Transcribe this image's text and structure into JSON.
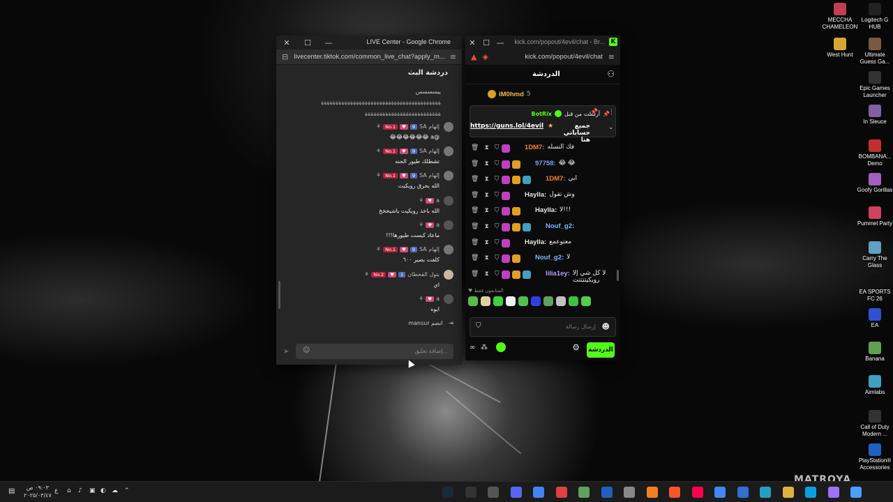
{
  "desktop_icons": [
    {
      "label": "MECCHA CHAMELEON",
      "icon": "meccha-chameleon-icon",
      "color": "#c04050"
    },
    {
      "label": "Logitech G HUB",
      "icon": "logitech-g-icon",
      "color": "#222222"
    },
    {
      "label": "West Hunt",
      "icon": "west-hunt-icon",
      "color": "#d8a530"
    },
    {
      "label": "Ultimate Guess Ga...",
      "icon": "guess-game-icon",
      "color": "#7a5a40"
    },
    {
      "label": "Epic Games Launcher",
      "icon": "epic-games-icon",
      "color": "#333333"
    },
    {
      "label": "In Sleuce",
      "icon": "in-sleuce-icon",
      "color": "#8060a0"
    },
    {
      "label": "BOMBANA... Demo",
      "icon": "bombana-icon",
      "color": "#c03030"
    },
    {
      "label": "Goofy Gorillas",
      "icon": "goofy-gorillas-icon",
      "color": "#a060c0"
    },
    {
      "label": "Pummel Party",
      "icon": "pummel-party-icon",
      "color": "#d04060"
    },
    {
      "label": "Carry The Glass",
      "icon": "carry-glass-icon",
      "color": "#60a0c0"
    },
    {
      "label": "EA SPORTS FC 26",
      "icon": "ea-fc-icon",
      "color": "#111111"
    },
    {
      "label": "EA",
      "icon": "ea-icon",
      "color": "#3050d0"
    },
    {
      "label": "Banana",
      "icon": "banana-icon",
      "color": "#60a050"
    },
    {
      "label": "Aimlabs",
      "icon": "aimlabs-icon",
      "color": "#40a0c0"
    },
    {
      "label": "Call of Duty Modern ...",
      "icon": "call-of-duty-icon",
      "color": "#333333"
    },
    {
      "label": "PlayStation® Accessories",
      "icon": "playstation-icon",
      "color": "#2060c0"
    }
  ],
  "tiktok_window": {
    "title": "LIVE Center - Google Chrome",
    "url": "livecenter.tiktok.com/common_live_chat?apply_m...",
    "chat_title": "دردشة البث",
    "top_lines": [
      "ييسسسس",
      "ةةةةةةةةةةةةةةةةةةةةةةةةةةةةةةةةةةةةةةةةة",
      "ةةةةةةةةةةةةةةةةةةةةةةةةةة"
    ],
    "messages": [
      {
        "user": "إلهام SA",
        "level": "9",
        "rank": "No.1",
        "text": "@a 😂😂😂😂😂😂",
        "avatar_color": "#777777"
      },
      {
        "user": "إلهام SA",
        "level": "9",
        "rank": "No.1",
        "text": "تشطلك طيور الجنه",
        "avatar_color": "#777777"
      },
      {
        "user": "إلهام SA",
        "level": "9",
        "rank": "No.1",
        "text": "الله يحرق رويكيت",
        "avatar_color": "#777777"
      },
      {
        "user": "a",
        "level": "",
        "rank": "",
        "text": "الله ياخذ رويكيت ياشيخخخ",
        "avatar_color": "#555555"
      },
      {
        "user": "a",
        "level": "",
        "rank": "",
        "text": "ماعاد كبست طيورها!!!",
        "avatar_color": "#555555"
      },
      {
        "user": "إلهام SA",
        "level": "9",
        "rank": "No.1",
        "text": "كلفت بصير ٦٠٠",
        "avatar_color": "#777777"
      },
      {
        "user": "بتول القحطان",
        "level": "1",
        "rank": "No.2",
        "text": "اي",
        "avatar_color": "#c8b8a0"
      },
      {
        "user": "a",
        "level": "",
        "rank": "",
        "text": "ايوه",
        "avatar_color": "#555555"
      }
    ],
    "join_text": "mansur انضم",
    "input_placeholder": "إضافة تعليق..."
  },
  "kick_window": {
    "title": "kick.com/popout/4evil/chat - Br...",
    "url": "kick.com/popout/4evil/chat",
    "chat_title": "الدردشة",
    "top_user": "iM0hmd",
    "top_count": "5",
    "pinned": {
      "sent_by": "أرسلت من قبل",
      "user": "BotRix",
      "text": "جميع حساباتي هنا",
      "link": "https://guns.lol/4evil"
    },
    "messages": [
      {
        "user": "1DM7:",
        "color": "#f08030",
        "text": "فك النسله"
      },
      {
        "user": "97758:",
        "color": "#7aa0ff",
        "text": "😂 😂"
      },
      {
        "user": "1DM7:",
        "color": "#f08030",
        "text": "ابي"
      },
      {
        "user": "Haylla:",
        "color": "#e8e8e8",
        "text": "وش تقول"
      },
      {
        "user": "Haylla:",
        "color": "#e8e8e8",
        "text": "لا!!!"
      },
      {
        "user": "Nouf_g2:",
        "color": "#7ab8ff",
        "text": ""
      },
      {
        "user": "Haylla:",
        "color": "#e8e8e8",
        "text": "معتوعمع"
      },
      {
        "user": "Nouf_g2:",
        "color": "#7ab8ff",
        "text": "لا"
      },
      {
        "user": "lilia1ey:",
        "color": "#b89cff",
        "text": "لا كل شي إلا رويكيتتتتت"
      }
    ],
    "emotes_label": "المتابعون فقط",
    "input_placeholder": "إرسال رسالة",
    "chat_button": "الدردشة",
    "watermark": "MATROYA"
  },
  "taskbar": {
    "time": "٠٩:٠٣ ص",
    "date": "٢٠٢٥/٠٣/٤٧",
    "lang": "ع",
    "apps": [
      "steam-icon",
      "epic-icon",
      "back-icon",
      "discord-icon",
      "chrome-tab-icon",
      "record-icon",
      "xbox-icon",
      "store-icon",
      "speed-icon",
      "cloudflare-icon",
      "brave-icon",
      "tiktok-icon",
      "chrome-icon",
      "mail-icon",
      "calendar-icon",
      "folder-icon",
      "edge-icon",
      "copilot-icon",
      "start-icon"
    ]
  }
}
